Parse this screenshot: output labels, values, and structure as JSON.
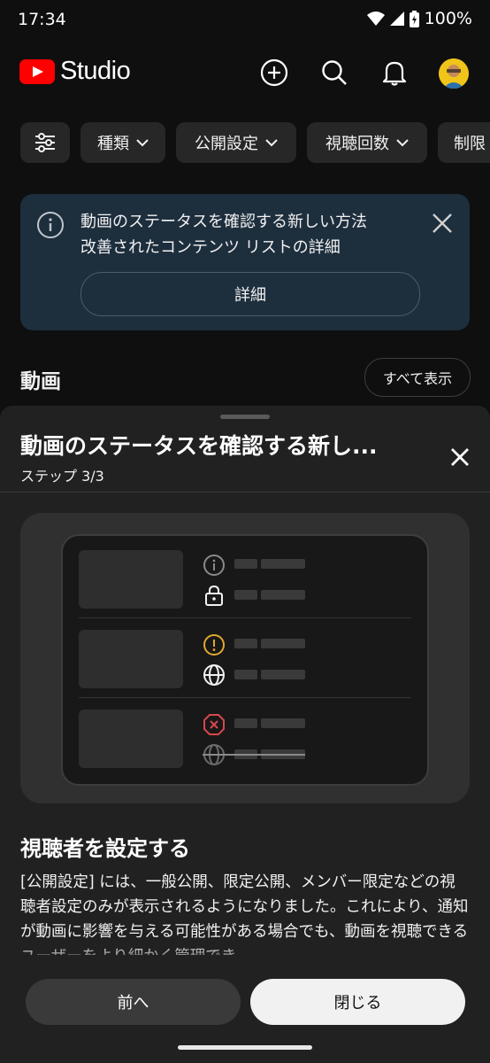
{
  "status_bar": {
    "time": "17:34",
    "battery": "100%"
  },
  "app_bar": {
    "logo_text": "Studio",
    "brand_color": "#ff0000"
  },
  "filters": {
    "filter_icon": "tune-icon",
    "chips": [
      {
        "label": "種類"
      },
      {
        "label": "公開設定"
      },
      {
        "label": "視聴回数"
      },
      {
        "label": "制限"
      }
    ]
  },
  "banner": {
    "line1": "動画のステータスを確認する新しい方法",
    "line2": "改善されたコンテンツ リストの詳細",
    "details_label": "詳細"
  },
  "videos": {
    "title": "動画",
    "show_all": "すべて表示"
  },
  "sheet": {
    "title": "動画のステータスを確認する新し...",
    "step": "ステップ 3/3",
    "heading": "視聴者を設定する",
    "body": "[公開設定] には、一般公開、限定公開、メンバー限定などの視聴者設定のみが表示されるようになりました。これにより、通知が動画に影響を与える可能性がある場合でも、動画を視聴できるユーザーをより細かく管理でき",
    "prev_label": "前へ",
    "close_label": "閉じる"
  },
  "colors": {
    "background": "#0f0f0f",
    "banner_bg": "#1d2e3d",
    "sheet_bg": "#212121",
    "warning": "#e0a92e",
    "error": "#d9474b"
  }
}
